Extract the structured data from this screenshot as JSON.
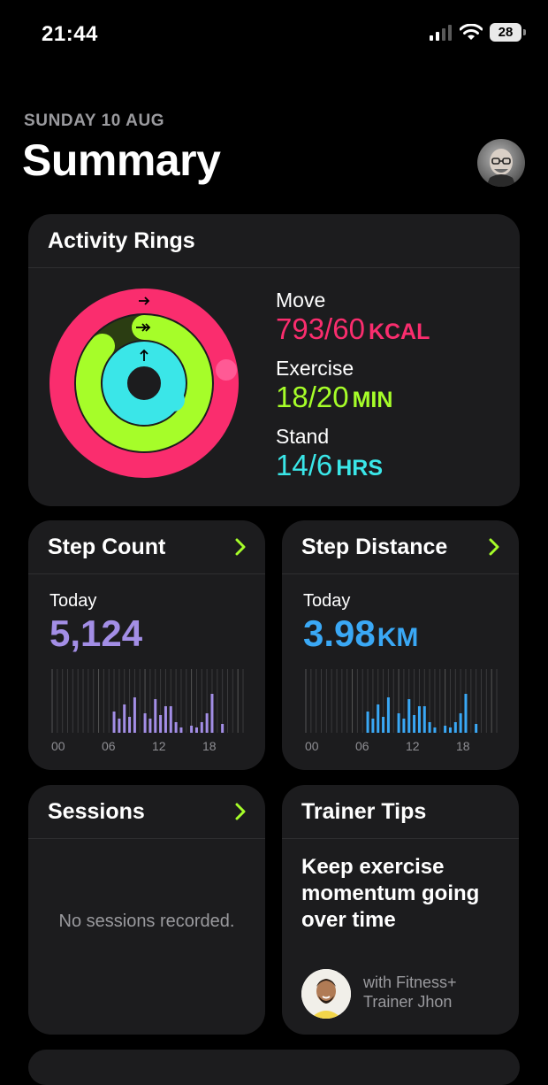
{
  "status": {
    "time": "21:44",
    "battery": "28"
  },
  "header": {
    "date": "SUNDAY 10 AUG",
    "title": "Summary"
  },
  "activity": {
    "title": "Activity Rings",
    "move": {
      "label": "Move",
      "value": "793/60",
      "unit": "KCAL",
      "color": "#fa2d6e"
    },
    "exercise": {
      "label": "Exercise",
      "value": "18/20",
      "unit": "MIN",
      "color": "#a6fd29"
    },
    "stand": {
      "label": "Stand",
      "value": "14/6",
      "unit": "HRS",
      "color": "#3ae6e8"
    }
  },
  "steps": {
    "title": "Step Count",
    "period": "Today",
    "value": "5,124",
    "color": "#a38ee6",
    "axis": [
      "00",
      "06",
      "12",
      "18"
    ]
  },
  "distance": {
    "title": "Step Distance",
    "period": "Today",
    "value": "3.98",
    "unit": "KM",
    "color": "#3aa8f5",
    "axis": [
      "00",
      "06",
      "12",
      "18"
    ]
  },
  "sessions": {
    "title": "Sessions",
    "empty": "No sessions recorded."
  },
  "tips": {
    "title": "Trainer Tips",
    "text": "Keep exercise momentum going over time",
    "trainer_line1": "with Fitness+",
    "trainer_line2": "Trainer Jhon"
  },
  "colors": {
    "accent": "#a6fd29",
    "card": "#1c1c1e",
    "muted": "#9a9a9e"
  }
}
